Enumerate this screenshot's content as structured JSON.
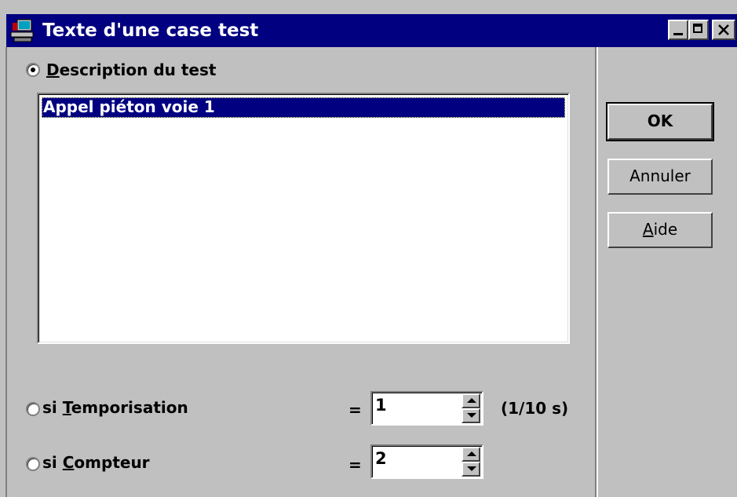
{
  "window": {
    "title": "Texte d'une case test"
  },
  "description": {
    "radio_label_underlined": "D",
    "radio_label_rest": "escription du test",
    "selected": true,
    "list_items": [
      "Appel piéton voie 1"
    ],
    "selected_index": 0
  },
  "buttons": {
    "ok_label": "OK",
    "cancel_label": "Annuler",
    "help_label_underlined": "A",
    "help_label_rest": "ide"
  },
  "temporisation": {
    "label_prefix": "si ",
    "label_underlined": "T",
    "label_rest": "emporisation",
    "equals": "=",
    "value": "1",
    "unit": "(1/10 s)",
    "selected": false
  },
  "compteur": {
    "label_prefix": "si ",
    "label_underlined": "C",
    "label_rest": "ompteur",
    "equals": "=",
    "value": "2",
    "selected": false
  },
  "colors": {
    "title_bar": "#000080",
    "face": "#c0c0c0",
    "selection": "#000080"
  }
}
